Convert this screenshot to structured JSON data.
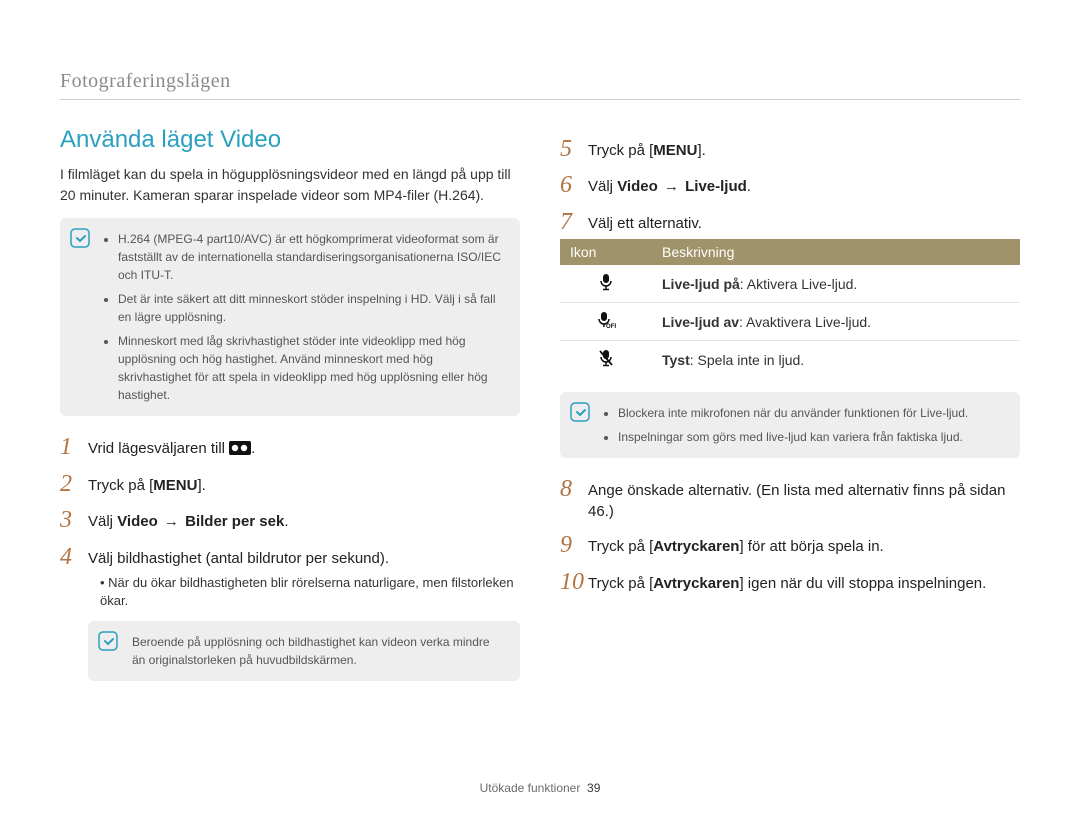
{
  "breadcrumb": "Fotograferingslägen",
  "section_title": "Använda läget Video",
  "intro": "I filmläget kan du spela in högupplösningsvideor med en längd på upp till 20 minuter. Kameran sparar inspelade videor som MP4-filer (H.264).",
  "note1": {
    "items": [
      "H.264 (MPEG-4 part10/AVC) är ett högkomprimerat videoformat som är fastställt av de internationella standardiseringsorganisationerna ISO/IEC och ITU-T.",
      "Det är inte säkert att ditt minneskort stöder inspelning i HD. Välj i så fall en lägre upplösning.",
      "Minneskort med låg skrivhastighet stöder inte videoklipp med hög upplösning och hög hastighet. Använd minneskort med hög skrivhastighet för att spela in videoklipp med hög upplösning eller hög hastighet."
    ]
  },
  "steps_left": {
    "s1_pre": "Vrid lägesväljaren till ",
    "s1_post": ".",
    "s2_pre": "Tryck på [",
    "s2_key": "MENU",
    "s2_post": "].",
    "s3_pre": "Välj ",
    "s3_b1": "Video",
    "s3_arrow": " → ",
    "s3_b2": "Bilder per sek",
    "s3_post": ".",
    "s4": "Välj bildhastighet (antal bildrutor per sekund).",
    "s4_sub": "När du ökar bildhastigheten blir rörelserna naturligare, men filstorleken ökar."
  },
  "note2": "Beroende på upplösning och bildhastighet kan videon verka mindre än originalstorleken på huvudbildskärmen.",
  "steps_right": {
    "s5_pre": "Tryck på [",
    "s5_key": "MENU",
    "s5_post": "].",
    "s6_pre": "Välj ",
    "s6_b1": "Video",
    "s6_arrow": " → ",
    "s6_b2": "Live-ljud",
    "s6_post": ".",
    "s7": "Välj ett alternativ."
  },
  "table": {
    "hdr_icon": "Ikon",
    "hdr_desc": "Beskrivning",
    "rows": [
      {
        "icon": "mic-on",
        "label": "Live-ljud på",
        "desc": ": Aktivera Live-ljud."
      },
      {
        "icon": "mic-off",
        "label": "Live-ljud av",
        "desc": ": Avaktivera Live-ljud."
      },
      {
        "icon": "mic-mute",
        "label": "Tyst",
        "desc": ": Spela inte in ljud."
      }
    ]
  },
  "note3": {
    "items": [
      "Blockera inte mikrofonen när du använder funktionen för Live-ljud.",
      "Inspelningar som görs med live-ljud kan variera från faktiska ljud."
    ]
  },
  "steps_right2": {
    "s8": "Ange önskade alternativ. (En lista med alternativ finns på sidan 46.)",
    "s9_pre": "Tryck på [",
    "s9_key": "Avtryckaren",
    "s9_post": "] för att börja spela in.",
    "s10_pre": "Tryck på [",
    "s10_key": "Avtryckaren",
    "s10_post": "] igen när du vill stoppa inspelningen."
  },
  "footer": {
    "label": "Utökade funktioner",
    "page": "39"
  },
  "step_numbers": {
    "n1": "1",
    "n2": "2",
    "n3": "3",
    "n4": "4",
    "n5": "5",
    "n6": "6",
    "n7": "7",
    "n8": "8",
    "n9": "9",
    "n10": "10"
  },
  "chart_data": null
}
